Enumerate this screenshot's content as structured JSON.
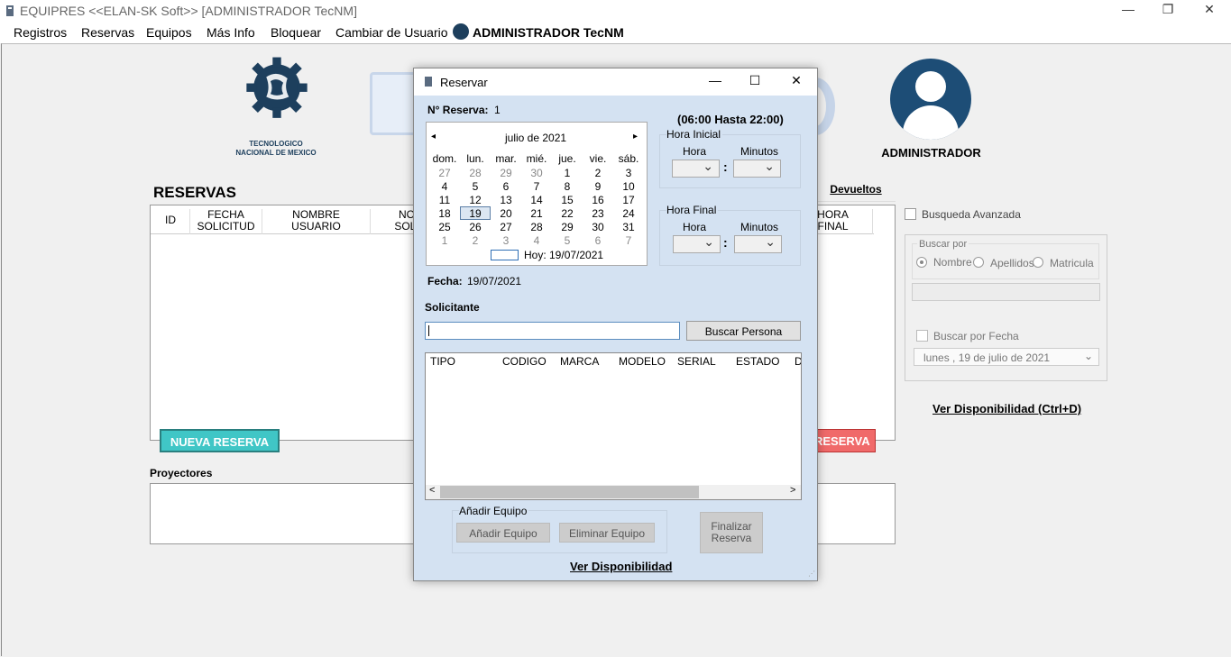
{
  "window": {
    "title": "EQUIPRES <<ELAN-SK Soft>> [ADMINISTRADOR TecNM]",
    "minimize": "—",
    "restore": "❐",
    "close": "✕"
  },
  "menu": {
    "items": [
      "Registros",
      "Reservas",
      "Equipos",
      "Más Info",
      "Bloquear",
      "Cambiar de Usuario"
    ],
    "user": "ADMINISTRADOR TecNM"
  },
  "logo": {
    "line1": "TECNOLOGICO",
    "line2": "NACIONAL DE MEXICO"
  },
  "profile": {
    "name": "ADMINISTRADOR"
  },
  "reservas": {
    "title": "RESERVAS",
    "devueltos": "Devueltos",
    "columns": [
      "ID",
      "FECHA\nSOLICITUD",
      "NOMBRE\nUSUARIO",
      "NO\nSOLI",
      "",
      "",
      "",
      "",
      "",
      "HORA\nFINAL"
    ],
    "col_id": "ID",
    "col_fecha": "FECHA SOLICITUD",
    "col_fecha_1": "FECHA",
    "col_fecha_2": "SOLICITUD",
    "col_nombre_1": "NOMBRE",
    "col_nombre_2": "USUARIO",
    "col_no_1": "NO",
    "col_no_2": "SOLI",
    "col_hora_1": "HORA",
    "col_hora_2": "FINAL",
    "nueva_btn": "NUEVA RESERVA",
    "cancel_btn": "RESERVA",
    "proyectores": "Proyectores"
  },
  "filters": {
    "busqueda_avanzada": "Busqueda Avanzada",
    "buscar_por": "Buscar por",
    "opt_nombre": "Nombre",
    "opt_apellidos": "Apellidos",
    "opt_matricula": "Matricula",
    "buscar_fecha": "Buscar por Fecha",
    "date_value": "lunes    , 19 de     julio     de 2021",
    "ver_disp": "Ver Disponibilidad (Ctrl+D)"
  },
  "dialog": {
    "title": "Reservar",
    "num_label": "N° Reserva:",
    "num_value": "1",
    "horario": "(06:00 Hasta 22:00)",
    "hora_inicial": "Hora Inicial",
    "hora_final": "Hora Final",
    "hora": "Hora",
    "minutos": "Minutos",
    "colon": ":",
    "fecha_label": "Fecha:",
    "fecha_value": "19/07/2021",
    "solicitante": "Solicitante",
    "buscar_persona": "Buscar Persona",
    "list_cols": [
      "TIPO",
      "CODIGO",
      "MARCA",
      "MODELO",
      "SERIAL",
      "ESTADO",
      "D"
    ],
    "anadir_group": "Añadir Equipo",
    "anadir_btn": "Añadir Equipo",
    "eliminar_btn": "Eliminar Equipo",
    "finalizar_1": "Finalizar",
    "finalizar_2": "Reserva",
    "ver_disp": "Ver Disponibilidad"
  },
  "calendar": {
    "month": "julio de 2021",
    "prev": "◂",
    "next": "▸",
    "weekdays": [
      "dom.",
      "lun.",
      "mar.",
      "mié.",
      "jue.",
      "vie.",
      "sáb."
    ],
    "weeks": [
      [
        "27",
        "28",
        "29",
        "30",
        "1",
        "2",
        "3"
      ],
      [
        "4",
        "5",
        "6",
        "7",
        "8",
        "9",
        "10"
      ],
      [
        "11",
        "12",
        "13",
        "14",
        "15",
        "16",
        "17"
      ],
      [
        "18",
        "19",
        "20",
        "21",
        "22",
        "23",
        "24"
      ],
      [
        "25",
        "26",
        "27",
        "28",
        "29",
        "30",
        "31"
      ],
      [
        "1",
        "2",
        "3",
        "4",
        "5",
        "6",
        "7"
      ]
    ],
    "today": "Hoy: 19/07/2021"
  },
  "colors": {
    "accent": "#40c6c6",
    "danger": "#f06a6a",
    "brand": "#1d4d76",
    "dialog_bg": "#d4e2f2"
  }
}
